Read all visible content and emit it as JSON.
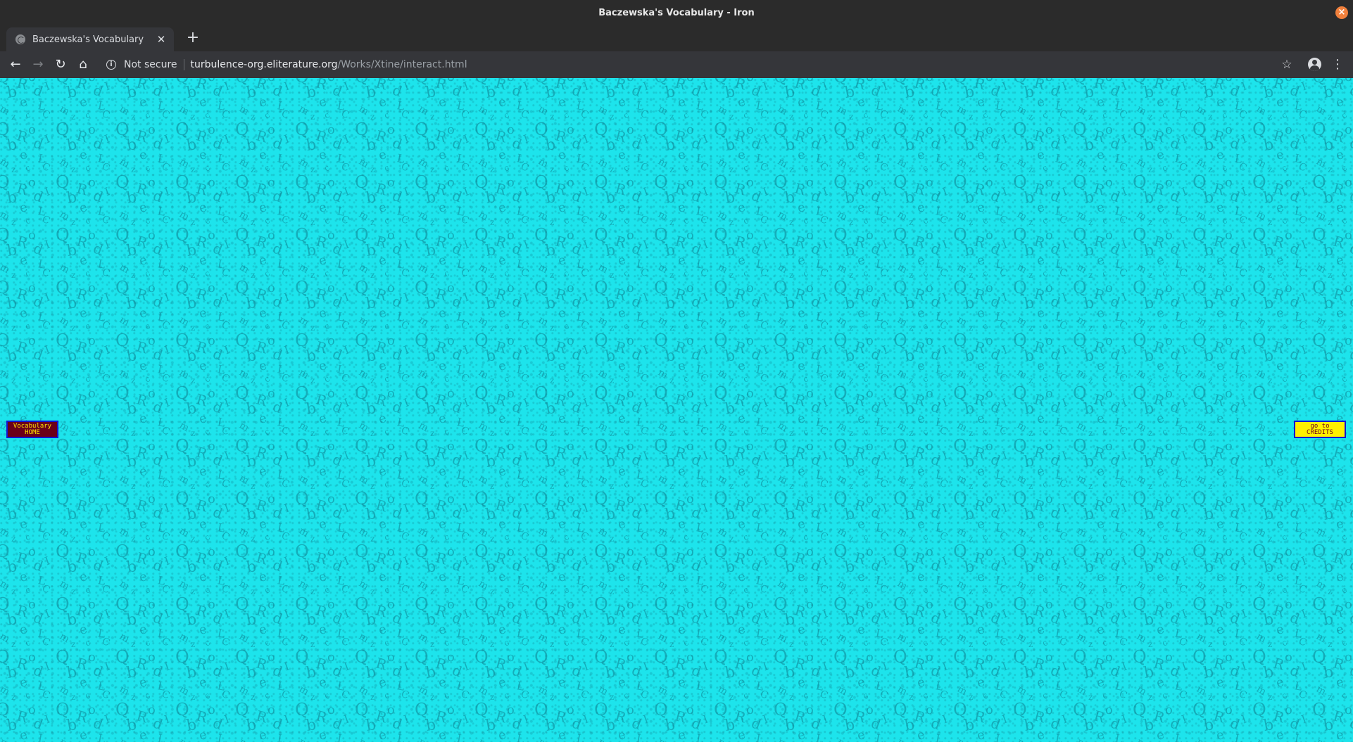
{
  "window": {
    "title": "Baczewska's Vocabulary - Iron"
  },
  "tabs": [
    {
      "label": "Baczewska's Vocabulary",
      "active": true
    }
  ],
  "toolbar": {
    "security_label": "Not secure",
    "url_host": "turbulence-org.eliterature.org",
    "url_path": "/Works/Xtine/interact.html"
  },
  "page": {
    "background_color": "#1de4ec",
    "background_glyphs": [
      "Q",
      "b",
      "R",
      "o",
      "d",
      "e",
      "L",
      "m",
      "I",
      "z",
      "C",
      "c"
    ],
    "home_link": {
      "line1": "Vocabulary",
      "line2": "HOME"
    },
    "credits_link": {
      "line1": "go to",
      "line2": "CREDITS"
    }
  },
  "colors": {
    "home_bg": "#6b0019",
    "home_text": "#ffe600",
    "credits_bg": "#fff000",
    "credits_text": "#6b0019",
    "box_border": "#1515d0"
  }
}
